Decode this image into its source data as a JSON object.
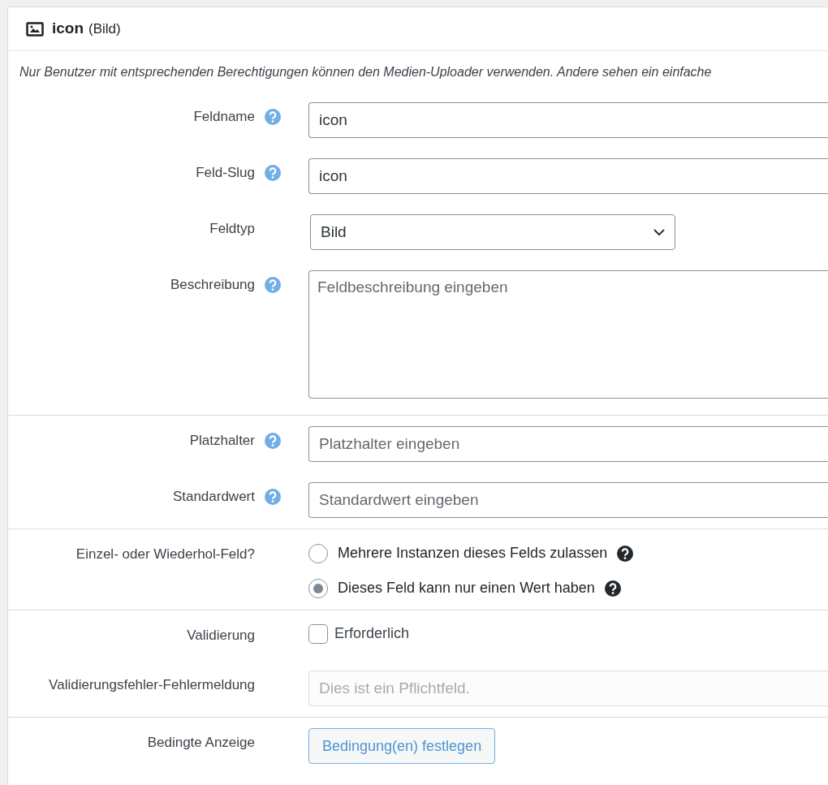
{
  "header": {
    "name": "icon",
    "type": "(Bild)"
  },
  "notice": "Nur Benutzer mit entsprechenden Berechtigungen können den Medien-Uploader verwenden. Andere sehen ein einfache",
  "sections": [
    {
      "rows": [
        {
          "kind": "text",
          "label": "Feldname",
          "help": true,
          "value": "icon"
        },
        {
          "kind": "text",
          "label": "Feld-Slug",
          "help": true,
          "value": "icon"
        },
        {
          "kind": "select",
          "label": "Feldtyp",
          "help": false,
          "value": "Bild"
        },
        {
          "kind": "textarea",
          "label": "Beschreibung",
          "help": true,
          "placeholder": "Feldbeschreibung eingeben"
        }
      ]
    },
    {
      "rows": [
        {
          "kind": "text",
          "label": "Platzhalter",
          "help": true,
          "placeholder": "Platzhalter eingeben"
        },
        {
          "kind": "text",
          "label": "Standardwert",
          "help": true,
          "placeholder": "Standardwert eingeben"
        }
      ]
    },
    {
      "rows": [
        {
          "kind": "radio",
          "label": "Einzel- oder Wiederhol-Feld?",
          "help": false,
          "options": [
            {
              "label": "Mehrere Instanzen dieses Felds zulassen",
              "selected": false,
              "help": true
            },
            {
              "label": "Dieses Feld kann nur einen Wert haben",
              "selected": true,
              "help": true
            }
          ]
        }
      ]
    },
    {
      "rows": [
        {
          "kind": "checkbox",
          "label": "Validierung",
          "help": false,
          "option": "Erforderlich",
          "checked": false
        },
        {
          "kind": "text",
          "label": "Validierungsfehler-Fehlermeldung",
          "help": false,
          "placeholder": "Dies ist ein Pflichtfeld.",
          "muted": true
        }
      ]
    },
    {
      "rows": [
        {
          "kind": "button",
          "label": "Bedingte Anzeige",
          "help": false,
          "button": "Bedingung(en) festlegen"
        }
      ]
    }
  ]
}
